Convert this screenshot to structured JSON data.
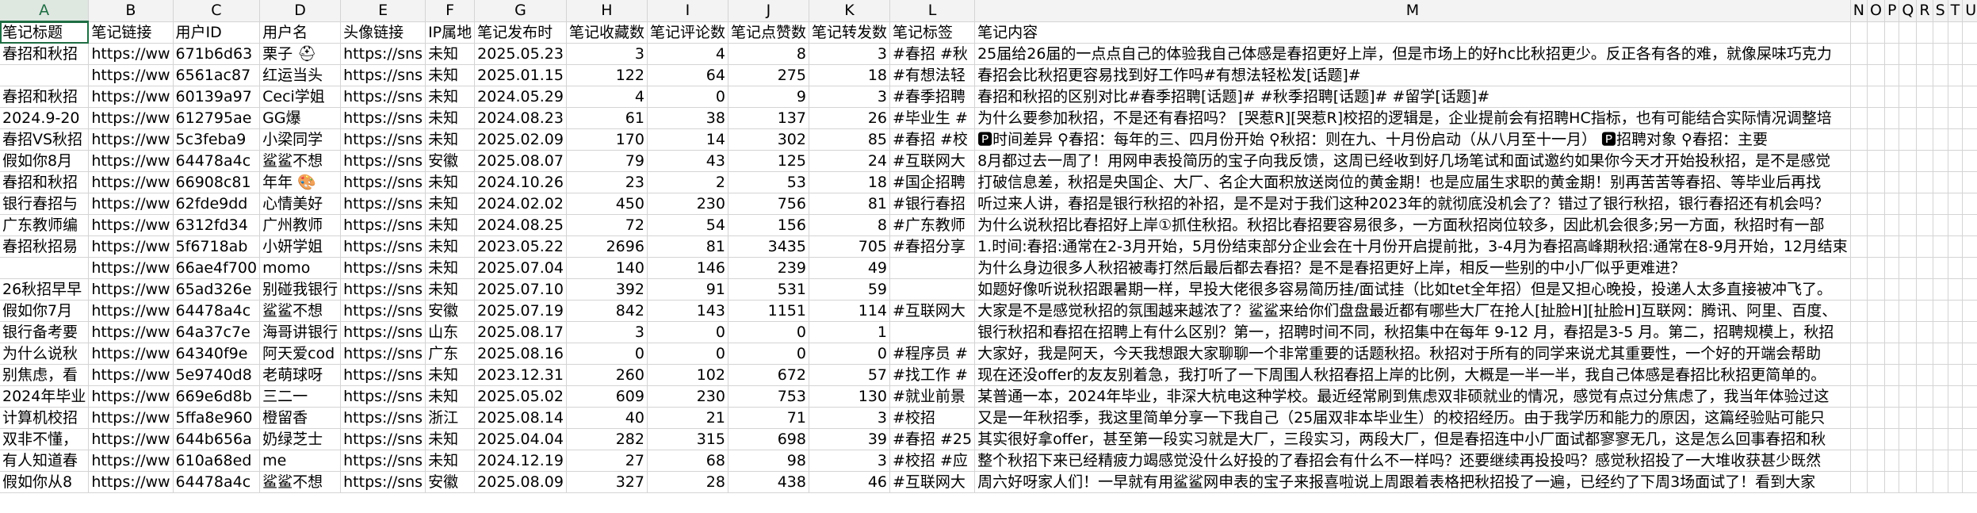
{
  "columns": [
    "A",
    "B",
    "C",
    "D",
    "E",
    "F",
    "G",
    "H",
    "I",
    "J",
    "K",
    "L",
    "M",
    "N",
    "O",
    "P",
    "Q",
    "R",
    "S",
    "T",
    "U",
    "V",
    "W",
    "X"
  ],
  "selected_column": "A",
  "headers": [
    "笔记标题",
    "笔记链接",
    "用户ID",
    "用户名",
    "头像链接",
    "IP属地",
    "笔记发布时",
    "笔记收藏数",
    "笔记评论数",
    "笔记点赞数",
    "笔记转发数",
    "笔记标签",
    "笔记内容"
  ],
  "rows": [
    [
      "春招和秋招",
      "https://ww",
      "671b6d63",
      "栗子 ⛑",
      "https://sns",
      "未知",
      "2025.05.23",
      "3",
      "4",
      "8",
      "3",
      "#春招 #秋",
      "25届给26届的一点点自己的体验我自己体感是春招更好上岸，但是市场上的好hc比秋招更少。反正各有各的难，就像屎味巧克力"
    ],
    [
      "",
      "https://ww",
      "6561ac87",
      "红运当头",
      "https://sns",
      "未知",
      "2025.01.15",
      "122",
      "64",
      "275",
      "18",
      "#有想法轻",
      "春招会比秋招更容易找到好工作吗#有想法轻松发[话题]#"
    ],
    [
      "春招和秋招",
      "https://ww",
      "60139a97",
      "Ceci学姐",
      "https://sns",
      "未知",
      "2024.05.29",
      "4",
      "0",
      "9",
      "3",
      "#春季招聘",
      "春招和秋招的区别对比#春季招聘[话题]# #秋季招聘[话题]# #留学[话题]#"
    ],
    [
      "2024.9-20",
      "https://ww",
      "612795ae",
      "GG爆",
      "https://sns",
      "未知",
      "2024.08.23",
      "61",
      "38",
      "137",
      "26",
      "#毕业生 #",
      "为什么要参加秋招，不是还有春招吗？ [哭惹R][哭惹R]校招的逻辑是，企业提前会有招聘HC指标，也有可能结合实际情况调整培"
    ],
    [
      "春招VS秋招",
      "https://ww",
      "5c3feba9",
      "小梁同学",
      "https://sns",
      "未知",
      "2025.02.09",
      "170",
      "14",
      "302",
      "85",
      "#春招 #校",
      "🅿时间差异 ⚲春招：每年的三、四月份开始 ⚲秋招：则在九、十月份启动（从八月至十一月） 🅿招聘对象 ⚲春招：主要"
    ],
    [
      "假如你8月",
      "https://ww",
      "64478a4c",
      "鲨鲨不想",
      "https://sns",
      "安徽",
      "2025.08.07",
      "79",
      "43",
      "125",
      "24",
      "#互联网大",
      "8月都过去一周了！用网申表投简历的宝子向我反馈，这周已经收到好几场笔试和面试邀约如果你今天才开始投秋招，是不是感觉"
    ],
    [
      "春招和秋招",
      "https://ww",
      "66908c81",
      "年年 🎨",
      "https://sns",
      "未知",
      "2024.10.26",
      "23",
      "2",
      "53",
      "18",
      "#国企招聘",
      "打破信息差，秋招是央国企、大厂、名企大面积放送岗位的黄金期！也是应届生求职的黄金期！别再苦苦等春招、等毕业后再找"
    ],
    [
      "银行春招与",
      "https://ww",
      "62fde9dd",
      "心情美好",
      "https://sns",
      "未知",
      "2024.02.02",
      "450",
      "230",
      "756",
      "81",
      "#银行春招",
      "听过来人讲，春招是银行秋招的补招，是不是对于我们这种2023年的就彻底没机会了？错过了银行秋招，银行春招还有机会吗？"
    ],
    [
      "广东教师编",
      "https://ww",
      "6312fd34",
      "广州教师",
      "https://sns",
      "未知",
      "2024.08.25",
      "72",
      "54",
      "156",
      "8",
      "#广东教师",
      "为什么说秋招比春招好上岸①抓住秋招。秋招比春招要容易很多，一方面秋招岗位较多，因此机会很多;另一方面，秋招时有一部"
    ],
    [
      "春招秋招易",
      "https://ww",
      "5f6718ab",
      "小妍学姐",
      "https://sns",
      "未知",
      "2023.05.22",
      "2696",
      "81",
      "3435",
      "705",
      "#春招分享",
      "1.时间:春招:通常在2-3月开始，5月份结束部分企业会在十月份开启提前批，3-4月为春招高峰期秋招:通常在8-9月开始，12月结束"
    ],
    [
      "",
      "https://ww",
      "66ae4f700",
      "momo",
      "https://sns",
      "未知",
      "2025.07.04",
      "140",
      "146",
      "239",
      "49",
      "",
      "为什么身边很多人秋招被毒打然后最后都去春招？是不是春招更好上岸，相反一些别的中小厂似乎更难进？"
    ],
    [
      "26秋招早早",
      "https://ww",
      "65ad326e",
      "别碰我银行",
      "https://sns",
      "未知",
      "2025.07.10",
      "392",
      "91",
      "531",
      "59",
      "",
      "如题好像听说秋招跟暑期一样，早投大佬很多容易简历挂/面试挂（比如tet全年招）但是又担心晚投，投递人太多直接被冲飞了。"
    ],
    [
      "假如你7月",
      "https://ww",
      "64478a4c",
      "鲨鲨不想",
      "https://sns",
      "安徽",
      "2025.07.19",
      "842",
      "143",
      "1151",
      "114",
      "#互联网大",
      "大家是不是感觉秋招的氛围越来越浓了？鲨鲨来给你们盘盘最近都有哪些大厂在抢人[扯脸H][扯脸H]互联网：腾讯、阿里、百度、"
    ],
    [
      "银行备考要",
      "https://ww",
      "64a37c7e",
      "海哥讲银行",
      "https://sns",
      "山东",
      "2025.08.17",
      "3",
      "0",
      "0",
      "1",
      "",
      "银行秋招和春招在招聘上有什么区别？第一，招聘时间不同，秋招集中在每年 9-12 月，春招是3-5 月。第二，招聘规模上，秋招"
    ],
    [
      "为什么说秋",
      "https://ww",
      "64340f9e",
      "阿天爱cod",
      "https://sns",
      "广东",
      "2025.08.16",
      "0",
      "0",
      "0",
      "0",
      "#程序员 #",
      "大家好，我是阿天，今天我想跟大家聊聊一个非常重要的话题秋招。秋招对于所有的同学来说尤其重要性，一个好的开端会帮助"
    ],
    [
      "别焦虑，看",
      "https://ww",
      "5e9740d8",
      "老萌球呀",
      "https://sns",
      "未知",
      "2023.12.31",
      "260",
      "102",
      "672",
      "57",
      "#找工作 #",
      "现在还没offer的友友别着急，我打听了一下周围人秋招春招上岸的比例，大概是一半一半，我自己体感是春招比秋招更简单的。"
    ],
    [
      "2024年毕业",
      "https://ww",
      "669e6d8b",
      "三二一",
      "https://sns",
      "未知",
      "2025.05.02",
      "609",
      "230",
      "753",
      "130",
      "#就业前景",
      "某普通一本，2024年毕业，非深大杭电这种学校。最近经常刷到焦虑双非硕就业的情况，感觉有点过分焦虑了，我当年体验过这"
    ],
    [
      "计算机校招",
      "https://ww",
      "5ffa8e960",
      "橙留香",
      "https://sns",
      "浙江",
      "2025.08.14",
      "40",
      "21",
      "71",
      "3",
      "#校招",
      "又是一年秋招季，我这里简单分享一下我自己（25届双非本毕业生）的校招经历。由于我学历和能力的原因，这篇经验贴可能只"
    ],
    [
      "双非不懂，",
      "https://ww",
      "644b656a",
      "奶绿芝士",
      "https://sns",
      "未知",
      "2025.04.04",
      "282",
      "315",
      "698",
      "39",
      "#春招 #25",
      "其实很好拿offer，甚至第一段实习就是大厂，三段实习，两段大厂，但是春招连中小厂面试都寥寥无几，这是怎么回事春招和秋"
    ],
    [
      "有人知道春",
      "https://ww",
      "610a68ed",
      "me",
      "https://sns",
      "未知",
      "2024.12.19",
      "27",
      "68",
      "98",
      "3",
      "#校招 #应",
      "整个秋招下来已经精疲力竭感觉没什么好投的了春招会有什么不一样吗？还要继续再投投吗？感觉秋招投了一大堆收获甚少既然"
    ],
    [
      "假如你从8",
      "https://ww",
      "64478a4c",
      "鲨鲨不想",
      "https://sns",
      "安徽",
      "2025.08.09",
      "327",
      "28",
      "438",
      "46",
      "#互联网大",
      "周六好呀家人们！一早就有用鲨鲨网申表的宝子来报喜啦说上周跟着表格把秋招投了一遍，已经约了下周3场面试了！看到大家"
    ]
  ]
}
